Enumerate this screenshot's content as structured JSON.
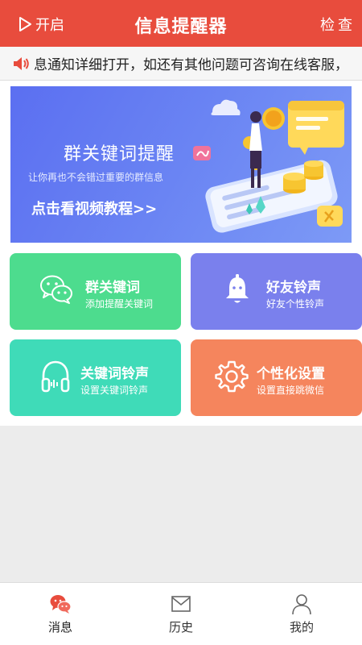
{
  "header": {
    "start_label": "开启",
    "title": "信息提醒器",
    "check_label": "检查"
  },
  "notice": {
    "text": "息通知详细打开，如还有其他问题可咨询在线客服，"
  },
  "banner": {
    "title": "群关键词提醒",
    "subtitle": "让你再也不会错过重要的群信息",
    "cta": "点击看视频教程>>"
  },
  "features": [
    {
      "title": "群关键词",
      "subtitle": "添加提醒关键词",
      "icon": "wechat-icon",
      "color": "#4ddc8e"
    },
    {
      "title": "好友铃声",
      "subtitle": "好友个性铃声",
      "icon": "bell-icon",
      "color": "#7a80ed"
    },
    {
      "title": "关键词铃声",
      "subtitle": "设置关键词铃声",
      "icon": "headphones-icon",
      "color": "#3fdbb8"
    },
    {
      "title": "个性化设置",
      "subtitle": "设置直接跳微信",
      "icon": "gear-icon",
      "color": "#f5855d"
    }
  ],
  "tabs": [
    {
      "label": "消息",
      "icon": "chat-bubbles-icon",
      "active": true
    },
    {
      "label": "历史",
      "icon": "envelope-icon",
      "active": false
    },
    {
      "label": "我的",
      "icon": "user-icon",
      "active": false
    }
  ],
  "colors": {
    "brand": "#e84c3d",
    "banner": "#6a84f3"
  }
}
